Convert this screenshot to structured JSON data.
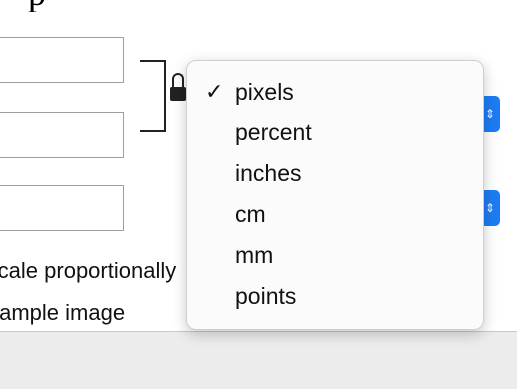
{
  "title_fragment": "p",
  "fields": {
    "width_value": "",
    "height_value": "",
    "resolution_value": ""
  },
  "options": {
    "scale_label": "Scale proportionally",
    "resample_label": "Resample image"
  },
  "unit_menu": {
    "selected": "pixels",
    "checkmark": "✓",
    "items": [
      "pixels",
      "percent",
      "inches",
      "cm",
      "mm",
      "points"
    ]
  },
  "icons": {
    "lock": "lock-icon",
    "stepper": "chevron-updown-icon",
    "check": "checkmark-icon"
  },
  "colors": {
    "accent": "#1d7cf3",
    "menu_background": "#fbfbfb",
    "window_background": "#ececec"
  }
}
